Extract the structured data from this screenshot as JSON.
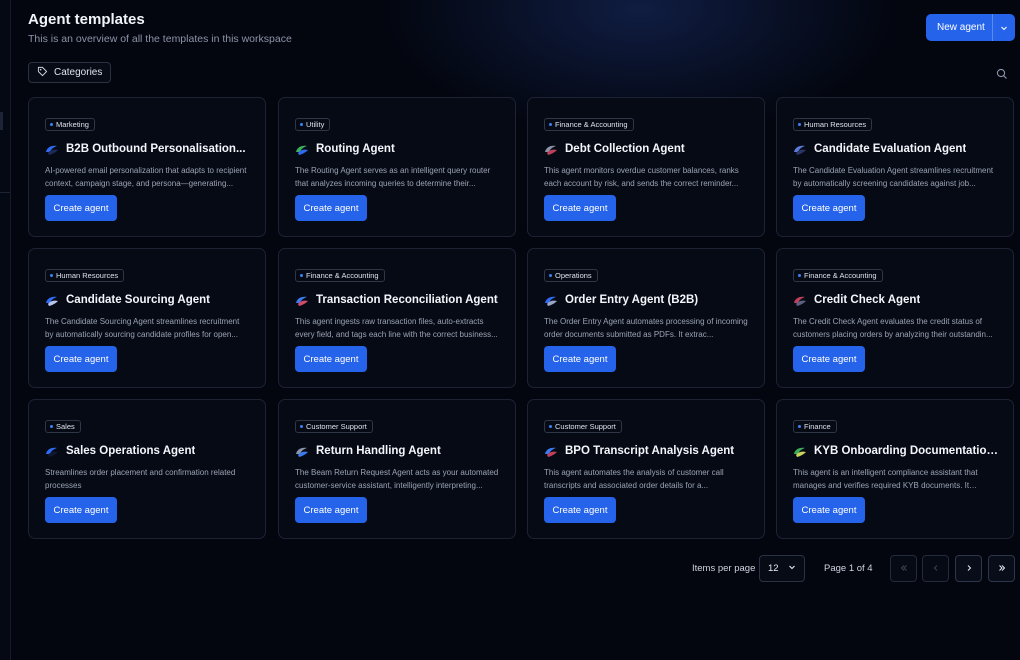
{
  "header": {
    "title": "Agent templates",
    "subtitle": "This is an overview of all the templates in this workspace",
    "new_agent_label": "New agent"
  },
  "filters": {
    "categories_label": "Categories"
  },
  "icons": {
    "tag": "tag-icon",
    "search": "search-icon",
    "chevron": "chevron-down-icon",
    "first": "chevrons-left-icon",
    "prev": "chevron-left-icon",
    "next": "chevron-right-icon",
    "last": "chevrons-right-icon"
  },
  "colors": {
    "accent": "#2563eb",
    "tag_dot": "#3b82f6",
    "background": "#03060f",
    "card": "#060a15"
  },
  "cards": [
    {
      "tag": "Marketing",
      "title": "B2B Outbound Personalisation...",
      "desc": "AI-powered email personalization that adapts to recipient context, campaign stage, and persona—generating...",
      "button": "Create agent",
      "avatar": [
        "#2f6bf2",
        "#1e2a55"
      ]
    },
    {
      "tag": "Utility",
      "title": "Routing Agent",
      "desc": "The Routing Agent serves as an intelligent query router that analyzes incoming queries to determine their...",
      "button": "Create agent",
      "avatar": [
        "#3fae5a",
        "#2f6bf2"
      ]
    },
    {
      "tag": "Finance & Accounting",
      "title": "Debt Collection Agent",
      "desc": "This agent monitors overdue customer balances, ranks each account by risk, and sends the correct reminder...",
      "button": "Create agent",
      "avatar": [
        "#8a93a8",
        "#c0405a"
      ]
    },
    {
      "tag": "Human Resources",
      "title": "Candidate Evaluation Agent",
      "desc": "The Candidate Evaluation Agent streamlines recruitment by automatically screening candidates against job...",
      "button": "Create agent",
      "avatar": [
        "#5b7bd8",
        "#2a3566"
      ]
    },
    {
      "tag": "Human Resources",
      "title": "Candidate Sourcing Agent",
      "desc": "The Candidate Sourcing Agent streamlines recruitment by automatically sourcing candidate profiles for open...",
      "button": "Create agent",
      "avatar": [
        "#2f6bf2",
        "#b8c4e8"
      ]
    },
    {
      "tag": "Finance & Accounting",
      "title": "Transaction Reconciliation Agent",
      "desc": "This agent ingests raw transaction files, auto-extracts every field, and tags each line with the correct business...",
      "button": "Create agent",
      "avatar": [
        "#3a7cf0",
        "#d04a6a"
      ]
    },
    {
      "tag": "Operations",
      "title": "Order Entry Agent (B2B)",
      "desc": "The Order Entry Agent automates processing of incoming order documents submitted as PDFs. It extrac...",
      "button": "Create agent",
      "avatar": [
        "#2f6bf2",
        "#9aa6c4"
      ]
    },
    {
      "tag": "Finance & Accounting",
      "title": "Credit Check Agent",
      "desc": "The Credit Check Agent evaluates the credit status of customers placing orders by analyzing their outstandin...",
      "button": "Create agent",
      "avatar": [
        "#c0405a",
        "#5a6080"
      ]
    },
    {
      "tag": "Sales",
      "title": "Sales Operations Agent",
      "desc": "Streamlines order placement and confirmation related processes",
      "button": "Create agent",
      "avatar": [
        "#2f6bf2",
        "#101830"
      ]
    },
    {
      "tag": "Customer Support",
      "title": "Return Handling Agent",
      "desc": "The Beam Return Request Agent acts as your automated customer-service assistant, intelligently interpreting...",
      "button": "Create agent",
      "avatar": [
        "#8a93a8",
        "#3a7cf0"
      ]
    },
    {
      "tag": "Customer Support",
      "title": "BPO Transcript Analysis Agent",
      "desc": "This agent automates the analysis of customer call transcripts and associated order details for a...",
      "button": "Create agent",
      "avatar": [
        "#3a7cf0",
        "#c0405a"
      ]
    },
    {
      "tag": "Finance",
      "title": "KYB Onboarding Documentation...",
      "desc": "This agent is an intelligent compliance assistant that manages and verifies required KYB documents. It guide...",
      "button": "Create agent",
      "avatar": [
        "#3fae5a",
        "#c9d25a"
      ]
    }
  ],
  "pagination": {
    "items_per_page_label": "Items per page",
    "items_per_page_value": "12",
    "page_label": "Page 1 of 4"
  }
}
